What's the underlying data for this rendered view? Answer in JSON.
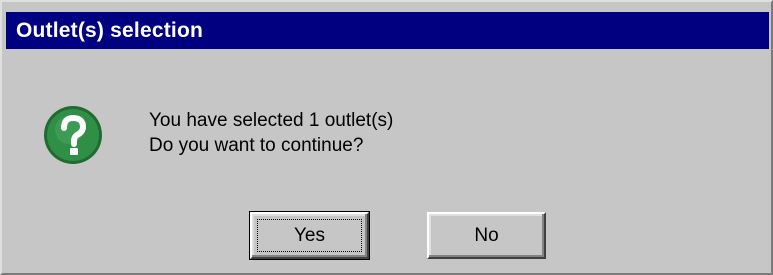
{
  "dialog": {
    "title": "Outlet(s) selection",
    "icon": "question-icon",
    "message_line1": "You have selected 1 outlet(s)",
    "message_line2": "Do you want to continue?",
    "buttons": {
      "yes_label": "Yes",
      "no_label": "No"
    },
    "colors": {
      "titlebar": "#000080",
      "background": "#c6c6c6",
      "icon_fill": "#2f8f46"
    }
  }
}
